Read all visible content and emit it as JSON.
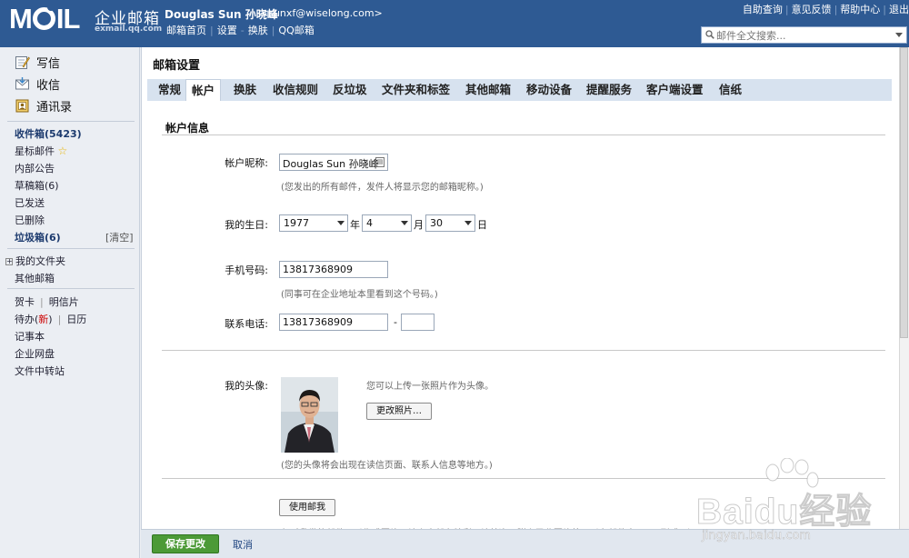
{
  "header": {
    "logo_text": "MOIL",
    "logo_cn": "企业邮箱",
    "logo_sub": "exmail.qq.com",
    "user_name": "Douglas Sun 孙晓峰",
    "user_email": "<sunxf@wiselong.com>",
    "nav": [
      "邮箱首页",
      "设置",
      "换肤",
      "QQ邮箱"
    ],
    "top_links": [
      "自助查询",
      "意见反馈",
      "帮助中心",
      "退出"
    ],
    "search_placeholder": "邮件全文搜索...",
    "bg_color": "#2e5a93"
  },
  "sidebar": {
    "main": {
      "compose": "写信",
      "inbox": "收信",
      "contacts": "通讯录"
    },
    "folders": {
      "inbox": "收件箱(5423)",
      "starred": "星标邮件",
      "notice": "内部公告",
      "drafts": "草稿箱(6)",
      "sent": "已发送",
      "deleted": "已删除",
      "spam": "垃圾箱(6)",
      "clear": "[清空]"
    },
    "my_folders": "我的文件夹",
    "other_mailboxes": "其他邮箱",
    "tools": {
      "card": "贺卡",
      "postcard": "明信片",
      "todo": "待办",
      "todo_new": "新",
      "calendar": "日历",
      "notepad": "记事本",
      "disk": "企业网盘",
      "transfer": "文件中转站"
    }
  },
  "content": {
    "title": "邮箱设置",
    "tabs": [
      "常规",
      "帐户",
      "换肤",
      "收信规则",
      "反垃圾",
      "文件夹和标签",
      "其他邮箱",
      "移动设备",
      "提醒服务",
      "客户端设置",
      "信纸"
    ],
    "active_tab": "帐户",
    "section_title": "帐户信息",
    "nickname": {
      "label": "帐户昵称:",
      "value": "Douglas Sun 孙晓峰",
      "hint": "(您发出的所有邮件，发件人将显示您的邮箱昵称。)"
    },
    "birthday": {
      "label": "我的生日:",
      "year": "1977",
      "year_unit": "年",
      "month": "4",
      "month_unit": "月",
      "day": "30",
      "day_unit": "日"
    },
    "mobile": {
      "label": "手机号码:",
      "value": "13817368909",
      "hint": "(同事可在企业地址本里看到这个号码。)"
    },
    "phone": {
      "label": "联系电话:",
      "value": "13817368909",
      "dash": "-",
      "ext": ""
    },
    "avatar": {
      "label": "我的头像:",
      "upload_hint": "您可以上传一张照片作为头像。",
      "change_button": "更改照片…",
      "hint": "(您的头像将会出现在读信页面、联系人信息等地方。)"
    },
    "use_mail_button": "使用邮我",
    "bottom_partial": "仅对我发的邮件可以生成图片，让上寄邮有精彩，让纯净，附上已收图片将可以在邮件中Email形式一）"
  },
  "footer": {
    "save": "保存更改",
    "cancel": "取消"
  },
  "watermark": {
    "text": "Baidu经验",
    "url": "jingyan.baidu.com"
  }
}
